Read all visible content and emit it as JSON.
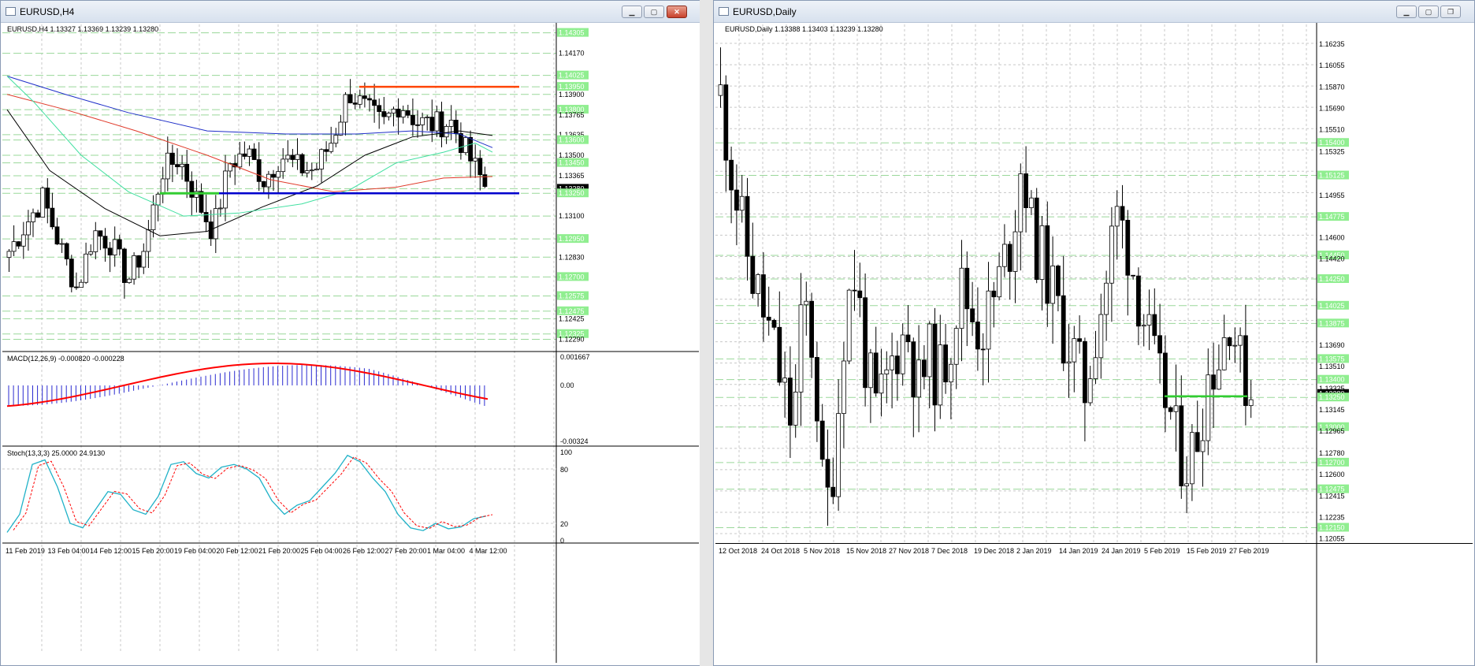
{
  "windows": [
    {
      "title": "EURUSD,H4",
      "header": "EURUSD,H4  1.13327 1.13369 1.13239 1.13280",
      "price_labels": [
        "1.14305",
        "1.14170",
        "1.14025",
        "1.13950",
        "1.13900",
        "1.13800",
        "1.13765",
        "1.13635",
        "1.13600",
        "1.13500",
        "1.13450",
        "1.13365",
        "1.13280",
        "1.13250",
        "1.13100",
        "1.12950",
        "1.12830",
        "1.12700",
        "1.12575",
        "1.12475",
        "1.12425",
        "1.12325",
        "1.12290"
      ],
      "macd_label": "MACD(12,26,9) -0.000820 -0.000228",
      "macd_scale": [
        "0.001667",
        "0.00",
        "-0.00324"
      ],
      "stoch_label": "Stoch(13,3,3) 25.0000 24.9130",
      "stoch_scale": [
        "100",
        "80",
        "20",
        "0"
      ],
      "time_labels": [
        "11 Feb 2019",
        "13 Feb 04:00",
        "14 Feb 12:00",
        "15 Feb 20:00",
        "19 Feb 04:00",
        "20 Feb 12:00",
        "21 Feb 20:00",
        "25 Feb 04:00",
        "26 Feb 12:00",
        "27 Feb 20:00",
        "1 Mar 04:00",
        "4 Mar 12:00"
      ]
    },
    {
      "title": "EURUSD,Daily",
      "header": "EURUSD,Daily  1.13388 1.13403 1.13239 1.13280",
      "price_labels": [
        "1.16235",
        "1.16055",
        "1.15870",
        "1.15690",
        "1.15510",
        "1.15400",
        "1.15325",
        "1.15125",
        "1.14955",
        "1.14775",
        "1.14600",
        "1.14450",
        "1.14420",
        "1.14250",
        "1.14025",
        "1.13875",
        "1.13690",
        "1.13575",
        "1.13510",
        "1.13400",
        "1.13325",
        "1.13280",
        "1.13250",
        "1.13145",
        "1.13000",
        "1.12965",
        "1.12780",
        "1.12700",
        "1.12600",
        "1.12475",
        "1.12415",
        "1.12235",
        "1.12150",
        "1.12055"
      ],
      "time_labels": [
        "12 Oct 2018",
        "24 Oct 2018",
        "5 Nov 2018",
        "15 Nov 2018",
        "27 Nov 2018",
        "7 Dec 2018",
        "19 Dec 2018",
        "2 Jan 2019",
        "14 Jan 2019",
        "24 Jan 2019",
        "5 Feb 2019",
        "15 Feb 2019",
        "27 Feb 2019"
      ]
    }
  ],
  "colors": {
    "bull_candle": "#ffffff",
    "bear_candle": "#000000",
    "grid": "#c8c8c8",
    "level_label_bg": "#90ee90",
    "resistance": "#ff4500",
    "support": "#0000cd",
    "green_level": "#32cd32",
    "ma_blue": "#1e2ec8",
    "ma_red": "#e03a2a",
    "ma_black": "#000000",
    "ma_aqua": "#40e0a0",
    "macd_hist": "#2a2ad0",
    "macd_signal": "#ff0000",
    "stoch_main": "#20b2c8",
    "stoch_signal": "#ff0000"
  }
}
